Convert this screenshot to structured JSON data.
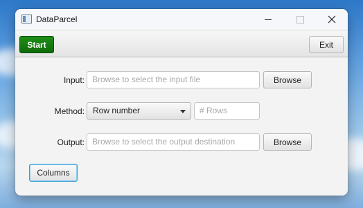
{
  "window": {
    "title": "DataParcel"
  },
  "toolbar": {
    "start_label": "Start",
    "exit_label": "Exit"
  },
  "form": {
    "input_label": "Input:",
    "input_placeholder": "Browse to select the input file",
    "method_label": "Method:",
    "method_selected": "Row number",
    "rows_placeholder": "# Rows",
    "output_label": "Output:",
    "output_placeholder": "Browse to select the output destination",
    "browse_label": "Browse",
    "columns_label": "Columns"
  },
  "colors": {
    "start_green": "#137a0e",
    "focus_blue": "#3aa0d6"
  }
}
